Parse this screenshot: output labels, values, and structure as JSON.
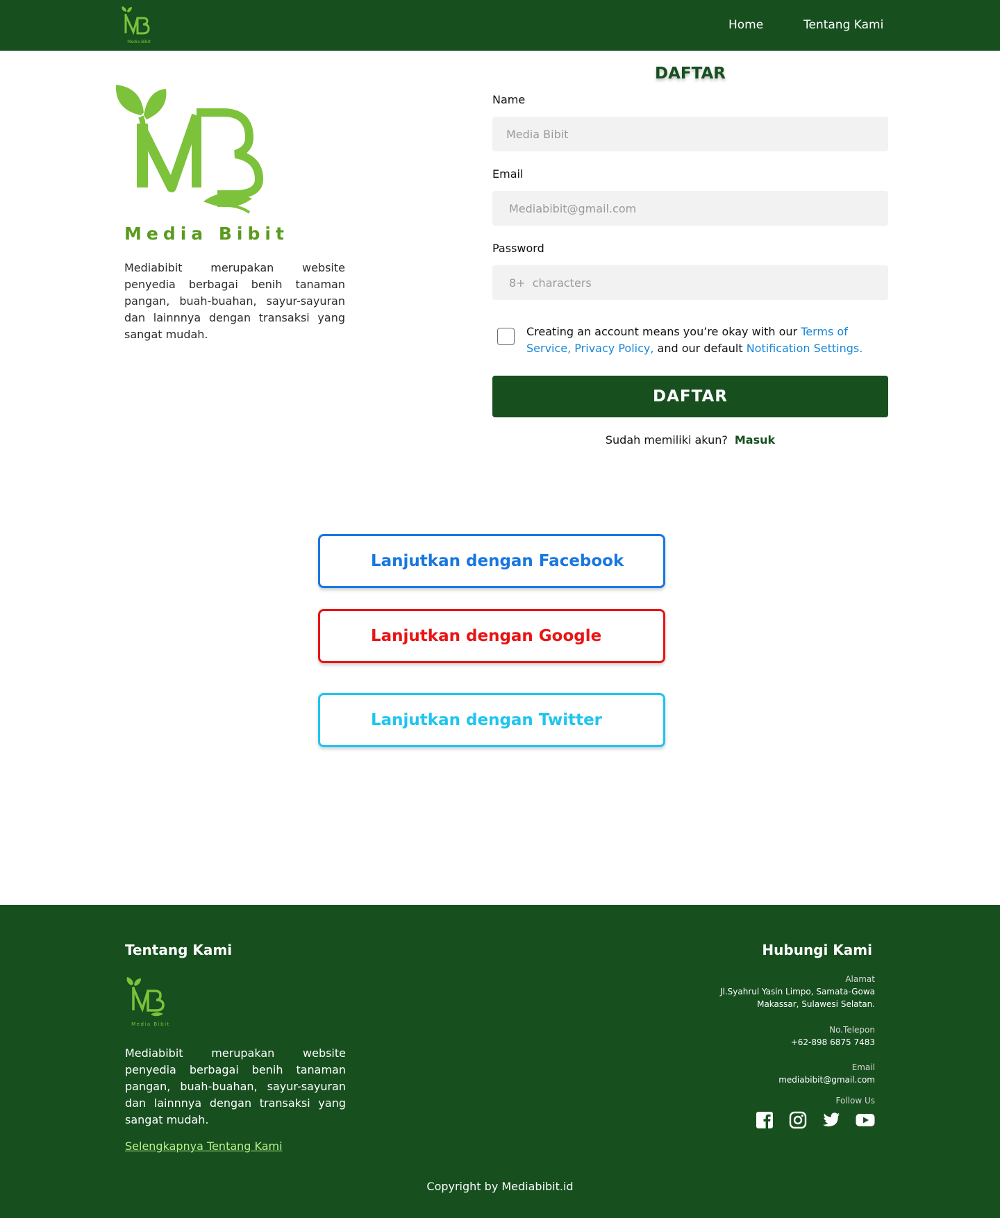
{
  "header": {
    "logo_text": "Media Bibit",
    "nav": [
      {
        "label": "Home"
      },
      {
        "label": "Tentang Kami"
      }
    ]
  },
  "brand": {
    "name": "Media Bibit",
    "description": "Mediabibit merupakan website penyedia berbagai benih tanaman pangan, buah-buahan, sayur-sayuran dan lainnnya dengan transaksi yang sangat mudah."
  },
  "form": {
    "title": "DAFTAR",
    "name_label": "Name",
    "name_placeholder": "Media Bibit",
    "email_label": "Email",
    "email_placeholder": "Mediabibit@gmail.com",
    "password_label": "Password",
    "password_placeholder": "8+  characters",
    "terms_prefix": "Creating an account means you’re okay with our ",
    "terms_link": "Terms of Service, Privacy Policy,",
    "terms_middle": " and our default ",
    "notification_link": "Notification Settings.",
    "submit_label": "DAFTAR",
    "login_prompt": "Sudah memiliki akun?",
    "login_link": "Masuk"
  },
  "social": {
    "facebook_label": "Lanjutkan dengan Facebook",
    "google_label": "Lanjutkan dengan Google",
    "twitter_label": "Lanjutkan dengan Twitter"
  },
  "footer": {
    "about_title": "Tentang Kami",
    "logo_text": "Media Bibit",
    "description": "Mediabibit merupakan website penyedia berbagai benih tanaman pangan, buah-buahan, sayur-sayuran dan lainnnya dengan transaksi yang sangat mudah.",
    "more_link": "Selengkapnya Tentang Kami",
    "contact_title": "Hubungi Kami",
    "address_label": "Alamat",
    "address_line1": "Jl.Syahrul Yasin Limpo, Samata-Gowa",
    "address_line2": "Makassar, Sulawesi Selatan.",
    "phone_label": "No.Telepon",
    "phone_value": "+62-898 6875 7483",
    "email_label": "Email",
    "email_value": "mediabibit@gmail.com",
    "follow_label": "Follow Us",
    "social_icons": [
      "facebook-icon",
      "instagram-icon",
      "twitter-icon",
      "youtube-icon"
    ],
    "copyright": "Copyright by Mediabibit.id"
  },
  "colors": {
    "primary_green": "#174f1f",
    "logo_green": "#7cc23b",
    "link_blue": "#1a86d8",
    "facebook_blue": "#1877e0",
    "google_red": "#ea1414",
    "twitter_cyan": "#1fc5ef"
  }
}
